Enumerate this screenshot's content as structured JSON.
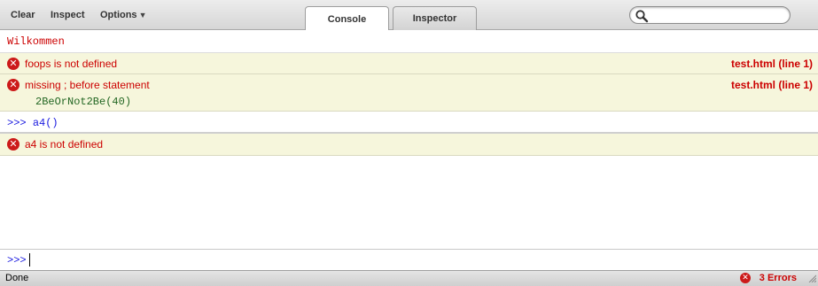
{
  "toolbar": {
    "clear_label": "Clear",
    "inspect_label": "Inspect",
    "options_label": "Options",
    "options_caret": "▼"
  },
  "tabs": [
    {
      "label": "Console",
      "active": true
    },
    {
      "label": "Inspector",
      "active": false
    }
  ],
  "search": {
    "value": "",
    "icon": "search-icon"
  },
  "console": {
    "log": {
      "text": "Wilkommen",
      "color": "#cc0000"
    },
    "errors": [
      {
        "icon": "error-icon",
        "message": "foops is not defined",
        "source": "test.html (line 1)"
      },
      {
        "icon": "error-icon",
        "message": "missing ; before statement",
        "source": "test.html (line 1)",
        "code": "2BeOrNot2Be(40)"
      },
      {
        "icon": "error-icon",
        "message": "a4 is not defined"
      }
    ],
    "command": {
      "prompt": ">>>",
      "text": "a4()"
    }
  },
  "command_line": {
    "prompt": ">>>",
    "value": ""
  },
  "status": {
    "text": "Done",
    "errors_label": "3 Errors"
  },
  "colors": {
    "error_text": "#cc0000",
    "error_row_bg": "#f6f6dc",
    "prompt_blue": "#1a1adf",
    "code_green": "#226622"
  }
}
